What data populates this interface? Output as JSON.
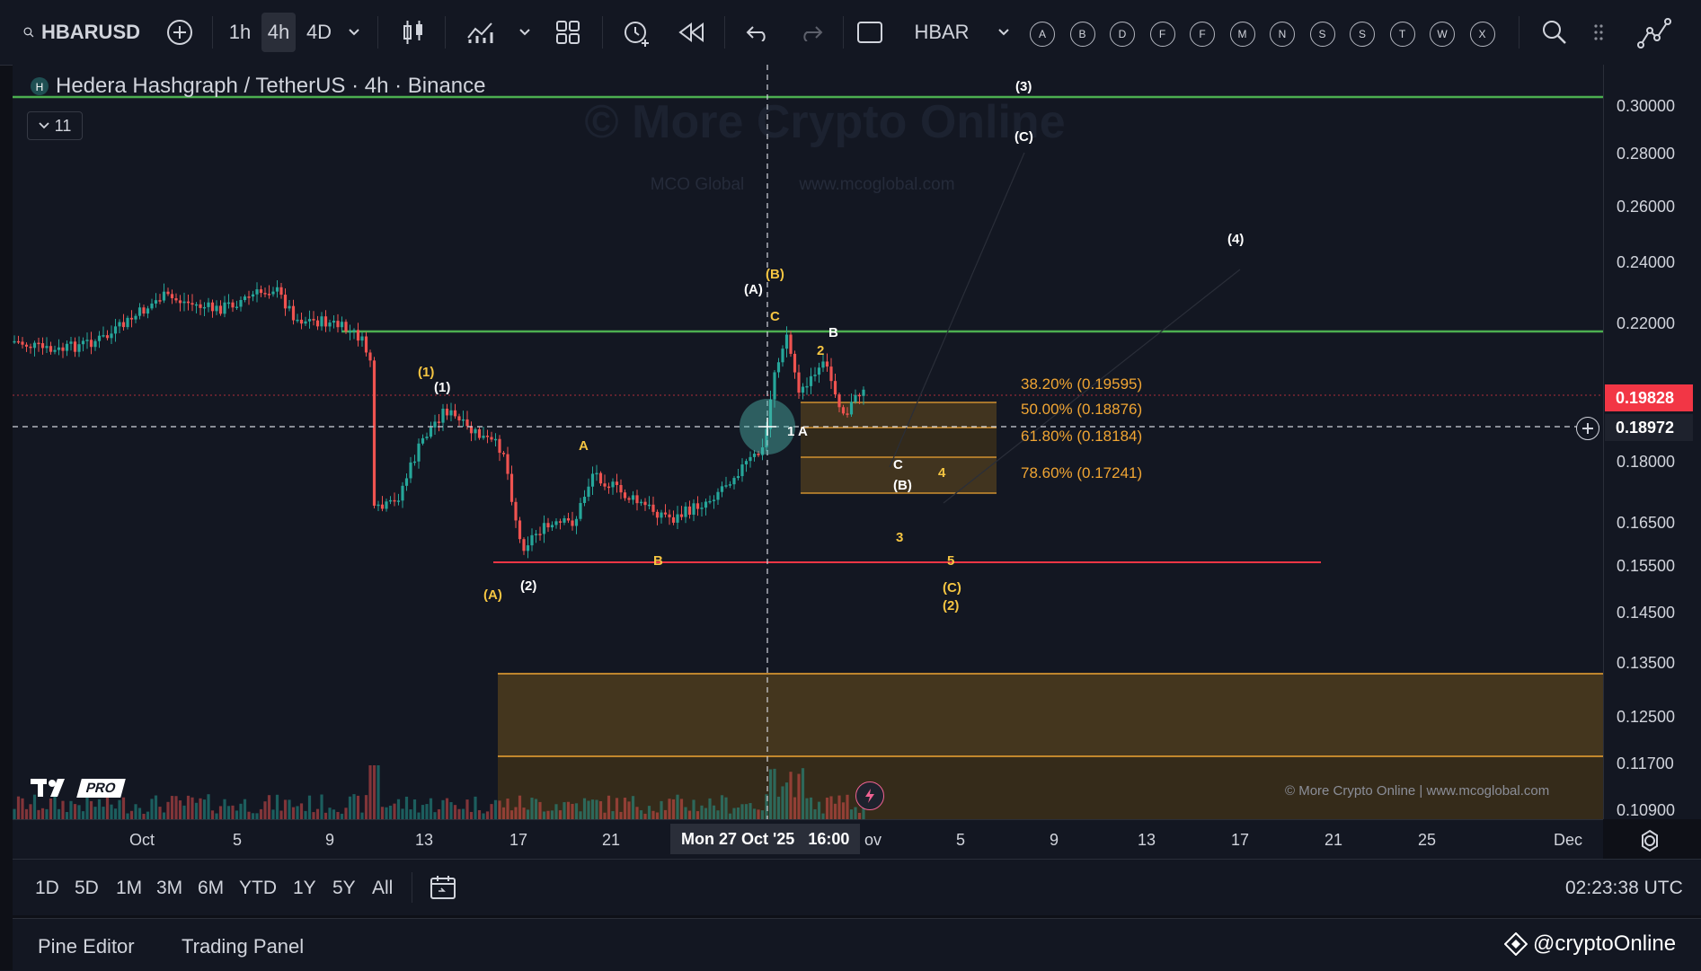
{
  "toolbar": {
    "symbol": "HBARUSD",
    "intervals": [
      "1h",
      "4h",
      "4D"
    ],
    "compare_symbol": "HBAR",
    "letter_buttons": [
      "A",
      "B",
      "D",
      "F",
      "F",
      "M",
      "N",
      "S",
      "S",
      "T",
      "W",
      "X"
    ]
  },
  "legend": {
    "title": "Hedera Hashgraph / TetherUS · 4h · Binance",
    "collapse_count": "11"
  },
  "watermark": {
    "line1": "© More Crypto Online",
    "line2a": "MCO Global",
    "line2b": "www.mcoglobal.com",
    "footer": "© More Crypto Online  |  www.mcoglobal.com",
    "brand": "PRO"
  },
  "price_axis": {
    "labels": [
      "0.30000",
      "0.28000",
      "0.26000",
      "0.24000",
      "0.22000",
      "0.18000",
      "0.16500",
      "0.15500",
      "0.14500",
      "0.13500",
      "0.12500",
      "0.11700",
      "0.10900"
    ],
    "current_price": "0.19828",
    "crosshair_price": "0.18972"
  },
  "time_axis": {
    "labels": [
      "Oct",
      "5",
      "9",
      "13",
      "17",
      "21",
      "ov",
      "5",
      "9",
      "13",
      "17",
      "21",
      "25",
      "Dec"
    ],
    "crosshair_label": "Mon 27 Oct '25   16:00"
  },
  "fib_levels": [
    {
      "label": "38.20% (0.19595)"
    },
    {
      "label": "50.00% (0.18876)"
    },
    {
      "label": "61.80% (0.18184)"
    },
    {
      "label": "78.60% (0.17241)"
    }
  ],
  "wave_labels": {
    "w3": "(3)",
    "wC_top": "(C)",
    "w4": "(4)",
    "wA_top": "(A)",
    "wB_top": "(B)",
    "c_top": "C",
    "b_top": "B",
    "two_small": "2",
    "one_y": "(1)",
    "one_w": "(1)",
    "a_mid": "A",
    "one_a": "1 A",
    "c_mid": "C",
    "b_mid": "(B)",
    "four": "4",
    "three": "3",
    "five": "5",
    "c_low": "(C)",
    "two_low": "(2)",
    "b_low": "B",
    "a_low": "(A)",
    "two_w": "(2)",
    "h_mark": "H"
  },
  "bottom": {
    "ranges": [
      "1D",
      "5D",
      "1M",
      "3M",
      "6M",
      "YTD",
      "1Y",
      "5Y",
      "All"
    ],
    "time": "02:23:38 UTC",
    "tabs": [
      "Pine Editor",
      "Trading Panel"
    ],
    "corner_text": "@cryptoOnline"
  },
  "colors": {
    "bg": "#131722",
    "up": "#26a69a",
    "down": "#ef5350",
    "green_line": "#4caf50",
    "red_line": "#f23645",
    "fib": "#f0a533",
    "zone": "#4a3a1e"
  }
}
